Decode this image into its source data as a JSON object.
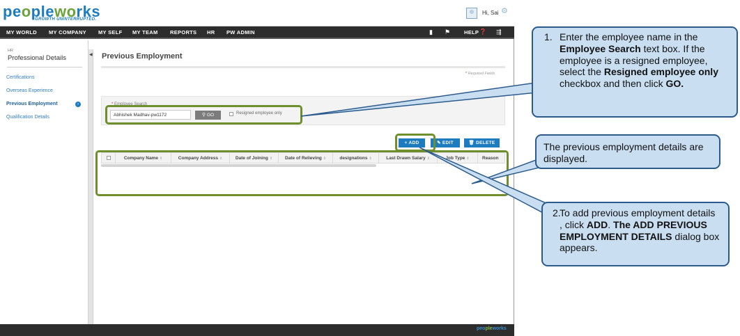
{
  "header": {
    "logo_part1": "pe",
    "logo_part2": "o",
    "logo_part3": "ple",
    "logo_part4": "w",
    "logo_part5": "o",
    "logo_part6": "rks",
    "tagline": "GROWTH UNINTERRUPTED.",
    "greeting": "Hi, Sai"
  },
  "nav": {
    "items": [
      "MY WORLD",
      "MY COMPANY",
      "MY SELF",
      "MY TEAM",
      "REPORTS",
      "HR",
      "PW ADMIN"
    ],
    "help": "HELP"
  },
  "left_panel": {
    "section": "HR",
    "title": "Professional Details",
    "items": [
      "Certifications",
      "Overseas Experience",
      "Previous Employment",
      "Qualification Details"
    ],
    "active_index": 2
  },
  "main": {
    "title": "Previous Employment",
    "required_note": "Required Fields",
    "search_label": "Employee Search",
    "search_value": "Abhishek Madhav-pw1172",
    "go_label": "GO",
    "resigned_label": "Resigned employee only",
    "add_label": "ADD",
    "edit_label": "EDIT",
    "delete_label": "DELETE",
    "columns": [
      "Company Name",
      "Company Address",
      "Date of Joining",
      "Date of Relieving",
      "designations",
      "Last Drawn Salary",
      "Job Type",
      "Reason"
    ]
  },
  "footer": {
    "logo1": "peo",
    "logo2": "ple",
    "logo3": "works"
  },
  "callouts": {
    "c1_num": "1.",
    "c1_t1": "Enter the employee name in the ",
    "c1_b1": "Employee Search",
    "c1_t2": "  text box. If the employee is a resigned employee, select  the ",
    "c1_b2": "Resigned employee only",
    "c1_t3": " checkbox and then  click ",
    "c1_b3": "GO.",
    "c2_text": "The previous employment details are displayed.",
    "c3_num": "2.",
    "c3_t1": "To add previous employment details , click ",
    "c3_b1": "ADD",
    "c3_t2": ". ",
    "c3_b2": "The ADD PREVIOUS EMPLOYMENT DETAILS",
    "c3_t3": " dialog box appears."
  },
  "colors": {
    "brand_blue": "#1d7bbf",
    "brand_green": "#6aa33a",
    "nav_bg": "#2d2d2d",
    "highlight_green": "#6f8f2c",
    "callout_fill": "#c9def1",
    "callout_border": "#2a5b8c"
  }
}
